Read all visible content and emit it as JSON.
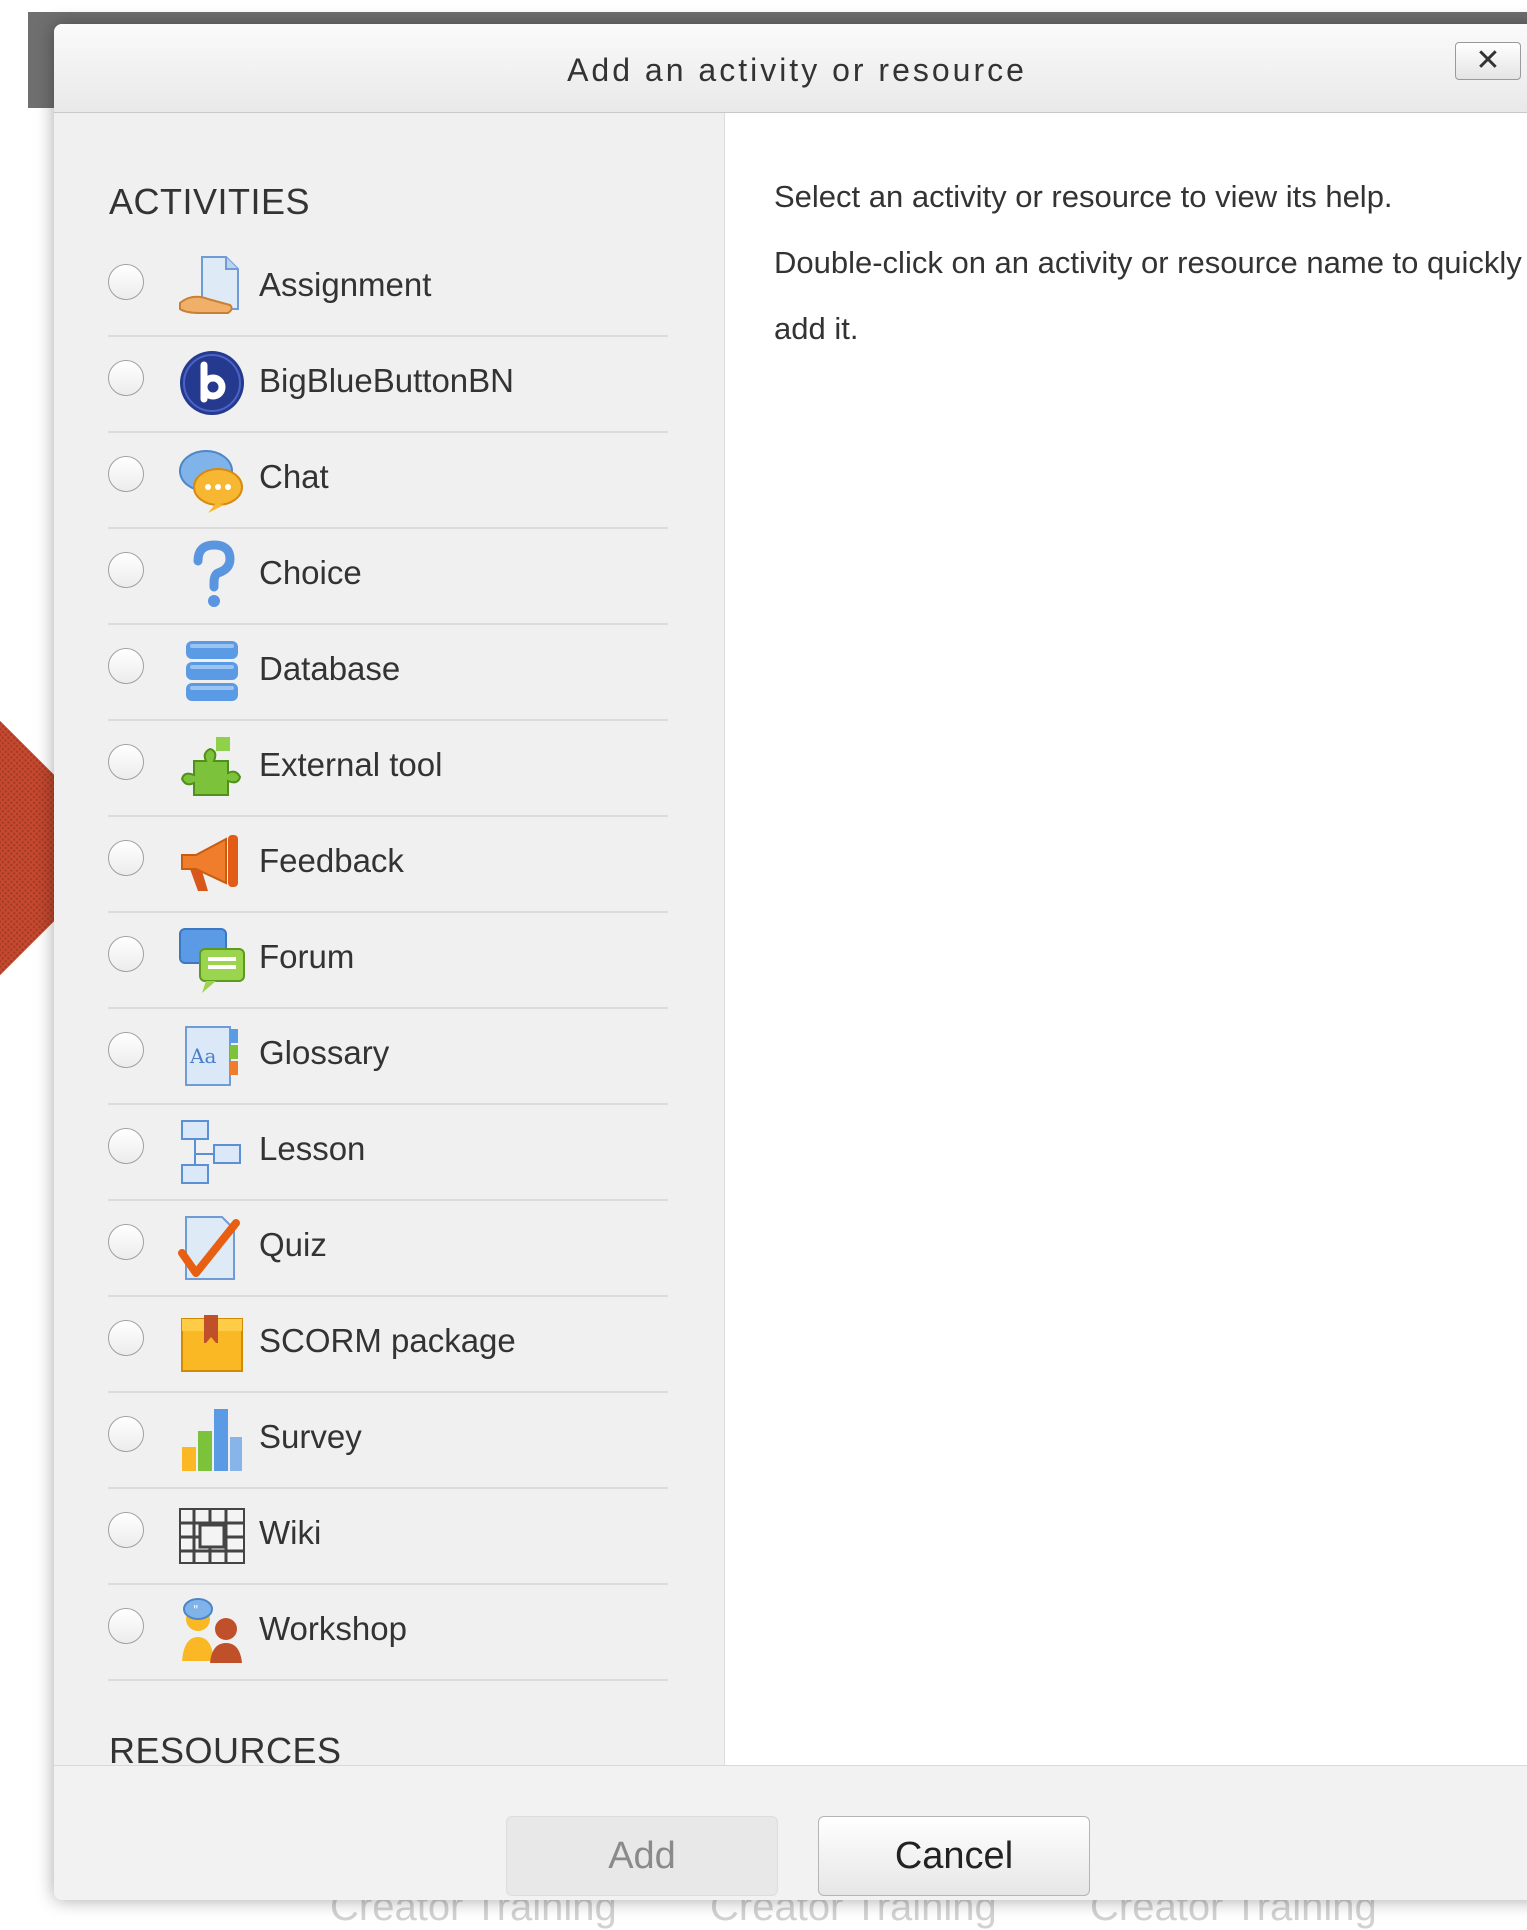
{
  "dialog": {
    "title": "Add an activity or resource",
    "close_label": "✕"
  },
  "activities": {
    "heading": "ACTIVITIES",
    "items": [
      {
        "label": "Assignment",
        "icon": "assignment-icon"
      },
      {
        "label": "BigBlueButtonBN",
        "icon": "bigbluebutton-icon"
      },
      {
        "label": "Chat",
        "icon": "chat-icon"
      },
      {
        "label": "Choice",
        "icon": "choice-icon"
      },
      {
        "label": "Database",
        "icon": "database-icon"
      },
      {
        "label": "External tool",
        "icon": "external-tool-icon"
      },
      {
        "label": "Feedback",
        "icon": "feedback-icon"
      },
      {
        "label": "Forum",
        "icon": "forum-icon"
      },
      {
        "label": "Glossary",
        "icon": "glossary-icon"
      },
      {
        "label": "Lesson",
        "icon": "lesson-icon"
      },
      {
        "label": "Quiz",
        "icon": "quiz-icon"
      },
      {
        "label": "SCORM package",
        "icon": "scorm-package-icon"
      },
      {
        "label": "Survey",
        "icon": "survey-icon"
      },
      {
        "label": "Wiki",
        "icon": "wiki-icon"
      },
      {
        "label": "Workshop",
        "icon": "workshop-icon"
      }
    ]
  },
  "resources": {
    "heading": "RESOURCES"
  },
  "help": {
    "line1": "Select an activity or resource to view its help.",
    "line2": "Double-click on an activity or resource name to quickly add it."
  },
  "footer": {
    "add_label": "Add",
    "cancel_label": "Cancel"
  },
  "background": {
    "faded_text": [
      "Creator Training",
      "Creator Training",
      "Creator Training"
    ]
  },
  "colors": {
    "dialog_header": "#eeeeee",
    "options_panel": "#f0f0f0",
    "pointer_arrow": "#c7492f",
    "text": "#333333"
  }
}
